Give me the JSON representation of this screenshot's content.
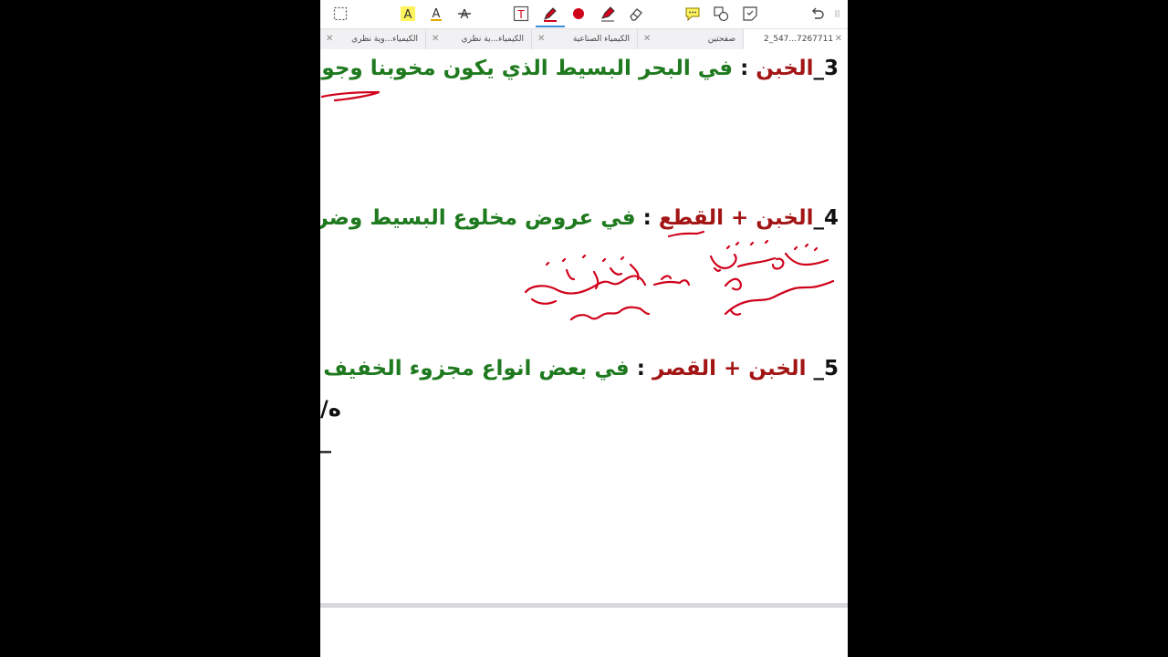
{
  "toolbar": {
    "tools": [
      {
        "name": "marquee-select-icon"
      },
      {
        "name": "highlight-text-icon",
        "glyph": "A"
      },
      {
        "name": "underline-text-icon",
        "glyph": "A"
      },
      {
        "name": "strikethrough-text-icon",
        "glyph": "A"
      },
      {
        "name": "text-box-icon",
        "glyph": "T"
      },
      {
        "name": "pen-icon"
      },
      {
        "name": "ink-color-icon"
      },
      {
        "name": "highlighter-icon"
      },
      {
        "name": "eraser-icon"
      },
      {
        "name": "comment-icon"
      },
      {
        "name": "shapes-icon"
      },
      {
        "name": "sticky-note-icon"
      },
      {
        "name": "undo-icon"
      },
      {
        "name": "more-icon"
      }
    ],
    "ink_color": "#d0021b",
    "accent": "#3b8fd4"
  },
  "tabs": [
    {
      "label": "2_547...7267711"
    },
    {
      "label": "صفحتين"
    },
    {
      "label": "الكيمياء الصناعية"
    },
    {
      "label": "الكيمياء...ية نظري"
    },
    {
      "label": "الكيمياء...وية نظري"
    }
  ],
  "document": {
    "line3": {
      "num": "3",
      "sep": "_",
      "term": "الخبن",
      "colon": " : ",
      "text": "في البحر البسيط الذي يكون مخوبنا وجوبا فتص"
    },
    "line4": {
      "num": "4",
      "sep": "_",
      "term": "الخبن + القطع",
      "colon": " : ",
      "text": "في عروض مخلوع البسيط وضربه فـ"
    },
    "line5": {
      "num": "5",
      "sep": "_ ",
      "term": "الخبن + القصر",
      "colon": " : ",
      "text": "في بعض انواع مجزوء الخفيف ( مُـ"
    },
    "frag1": "/ه",
    "frag2": "_"
  }
}
